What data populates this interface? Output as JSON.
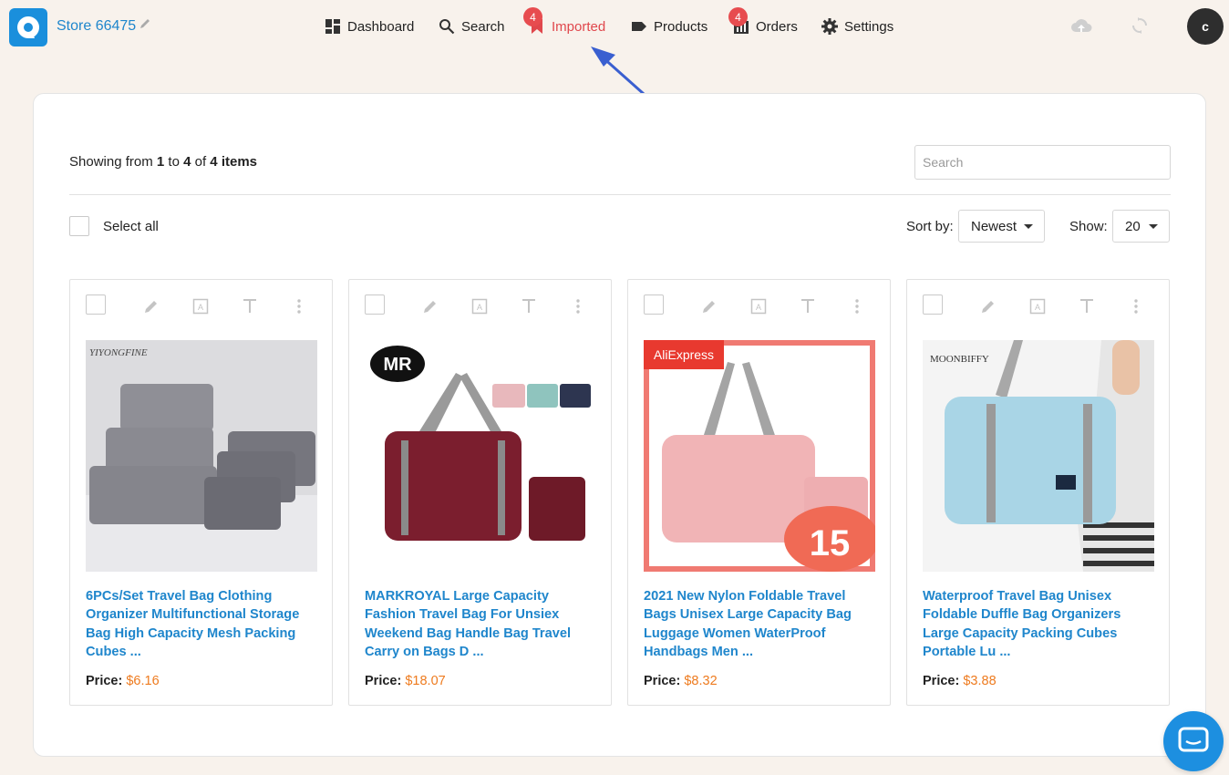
{
  "store": {
    "name": "Store 66475"
  },
  "nav": {
    "dashboard": "Dashboard",
    "search": "Search",
    "imported": "Imported",
    "imported_badge": "4",
    "products": "Products",
    "orders": "Orders",
    "orders_badge": "4",
    "settings": "Settings"
  },
  "user": {
    "avatar_initial": "c"
  },
  "list": {
    "showing_prefix": "Showing from",
    "from": "1",
    "to_word": "to",
    "to": "4",
    "of_word": "of",
    "total": "4",
    "items_word": "items",
    "search_placeholder": "Search",
    "select_all": "Select all",
    "sort_label": "Sort by:",
    "sort_value": "Newest",
    "show_label": "Show:",
    "show_value": "20"
  },
  "products": [
    {
      "title": "6PCs/Set Travel Bag Clothing Organizer Multifunctional Storage Bag High Capacity Mesh Packing Cubes ...",
      "price_label": "Price:",
      "price": "$6.16",
      "brand_text": "YIYONGFINE"
    },
    {
      "title": "MARKROYAL Large Capacity Fashion Travel Bag For Unsiex Weekend Bag Handle Bag Travel Carry on Bags D ...",
      "price_label": "Price:",
      "price": "$18.07",
      "brand_text": "MR"
    },
    {
      "title": "2021 New Nylon Foldable Travel Bags Unisex Large Capacity Bag Luggage Women WaterProof Handbags Men ...",
      "price_label": "Price:",
      "price": "$8.32",
      "brand_text": "AliExpress"
    },
    {
      "title": "Waterproof Travel Bag Unisex Foldable Duffle Bag Organizers Large Capacity Packing Cubes Portable Lu ...",
      "price_label": "Price:",
      "price": "$3.88",
      "brand_text": "MOONBIFFY"
    }
  ],
  "colors": {
    "accent": "#1f86cc",
    "active_nav": "#e0474c",
    "price": "#ee7b1f",
    "badge": "#e74c4f",
    "arrow": "#3a5fd0"
  }
}
